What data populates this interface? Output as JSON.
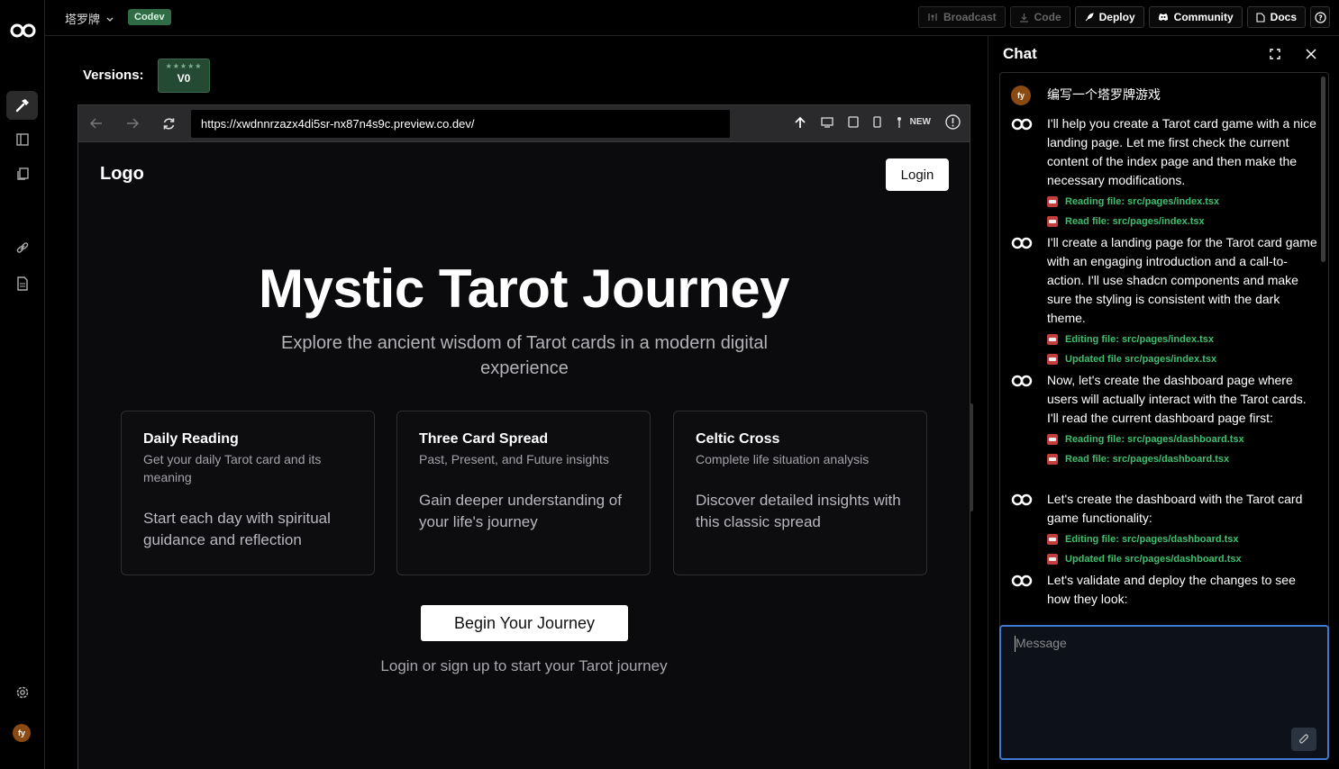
{
  "topbar": {
    "project_name": "塔罗牌",
    "env_badge": "Codev",
    "buttons": {
      "broadcast": "Broadcast",
      "code": "Code",
      "deploy": "Deploy",
      "community": "Community",
      "docs": "Docs"
    }
  },
  "versions": {
    "label": "Versions:",
    "current": "V0",
    "stars": "★★★★★"
  },
  "browser": {
    "url": "https://xwdnnrzazx4di5sr-nx87n4s9c.preview.co.dev/",
    "new_label": "NEW"
  },
  "site": {
    "logo": "Logo",
    "login": "Login",
    "title": "Mystic Tarot Journey",
    "subtitle": "Explore the ancient wisdom of Tarot cards in a modern digital experience",
    "cards": [
      {
        "title": "Daily Reading",
        "subtitle": "Get your daily Tarot card and its meaning",
        "body": "Start each day with spiritual guidance and reflection"
      },
      {
        "title": "Three Card Spread",
        "subtitle": "Past, Present, and Future insights",
        "body": "Gain deeper understanding of your life's journey"
      },
      {
        "title": "Celtic Cross",
        "subtitle": "Complete life situation analysis",
        "body": "Discover detailed insights with this classic spread"
      }
    ],
    "cta": "Begin Your Journey",
    "cta_note": "Login or sign up to start your Tarot journey"
  },
  "user": {
    "initials": "fy"
  },
  "chat": {
    "title": "Chat",
    "messages": [
      {
        "role": "user",
        "text": "编写一个塔罗牌游戏",
        "tools": []
      },
      {
        "role": "assistant",
        "text": "I'll help you create a Tarot card game with a nice landing page. Let me first check the current content of the index page and then make the necessary modifications.",
        "tools": [
          "Reading file: src/pages/index.tsx",
          "Read file: src/pages/index.tsx"
        ]
      },
      {
        "role": "assistant",
        "text": "I'll create a landing page for the Tarot card game with an engaging introduction and a call-to-action. I'll use shadcn components and make sure the styling is consistent with the dark theme.",
        "tools": [
          "Editing file: src/pages/index.tsx",
          "Updated file src/pages/index.tsx"
        ]
      },
      {
        "role": "assistant",
        "text": "Now, let's create the dashboard page where users will actually interact with the Tarot cards. I'll read the current dashboard page first:",
        "tools": [
          "Reading file: src/pages/dashboard.tsx",
          "Read file: src/pages/dashboard.tsx"
        ]
      },
      {
        "role": "assistant",
        "text": "Let's create the dashboard with the Tarot card game functionality:",
        "tools": [
          "Editing file: src/pages/dashboard.tsx",
          "Updated file src/pages/dashboard.tsx"
        ]
      },
      {
        "role": "assistant",
        "text": "Let's validate and deploy the changes to see how they look:",
        "tools": []
      }
    ],
    "input_placeholder": "Message"
  },
  "colors": {
    "accent_green": "#3fbf6e",
    "badge_green": "#2f6b44",
    "focus_blue": "#3d7ad0",
    "avatar_brown": "#8a4a12"
  }
}
